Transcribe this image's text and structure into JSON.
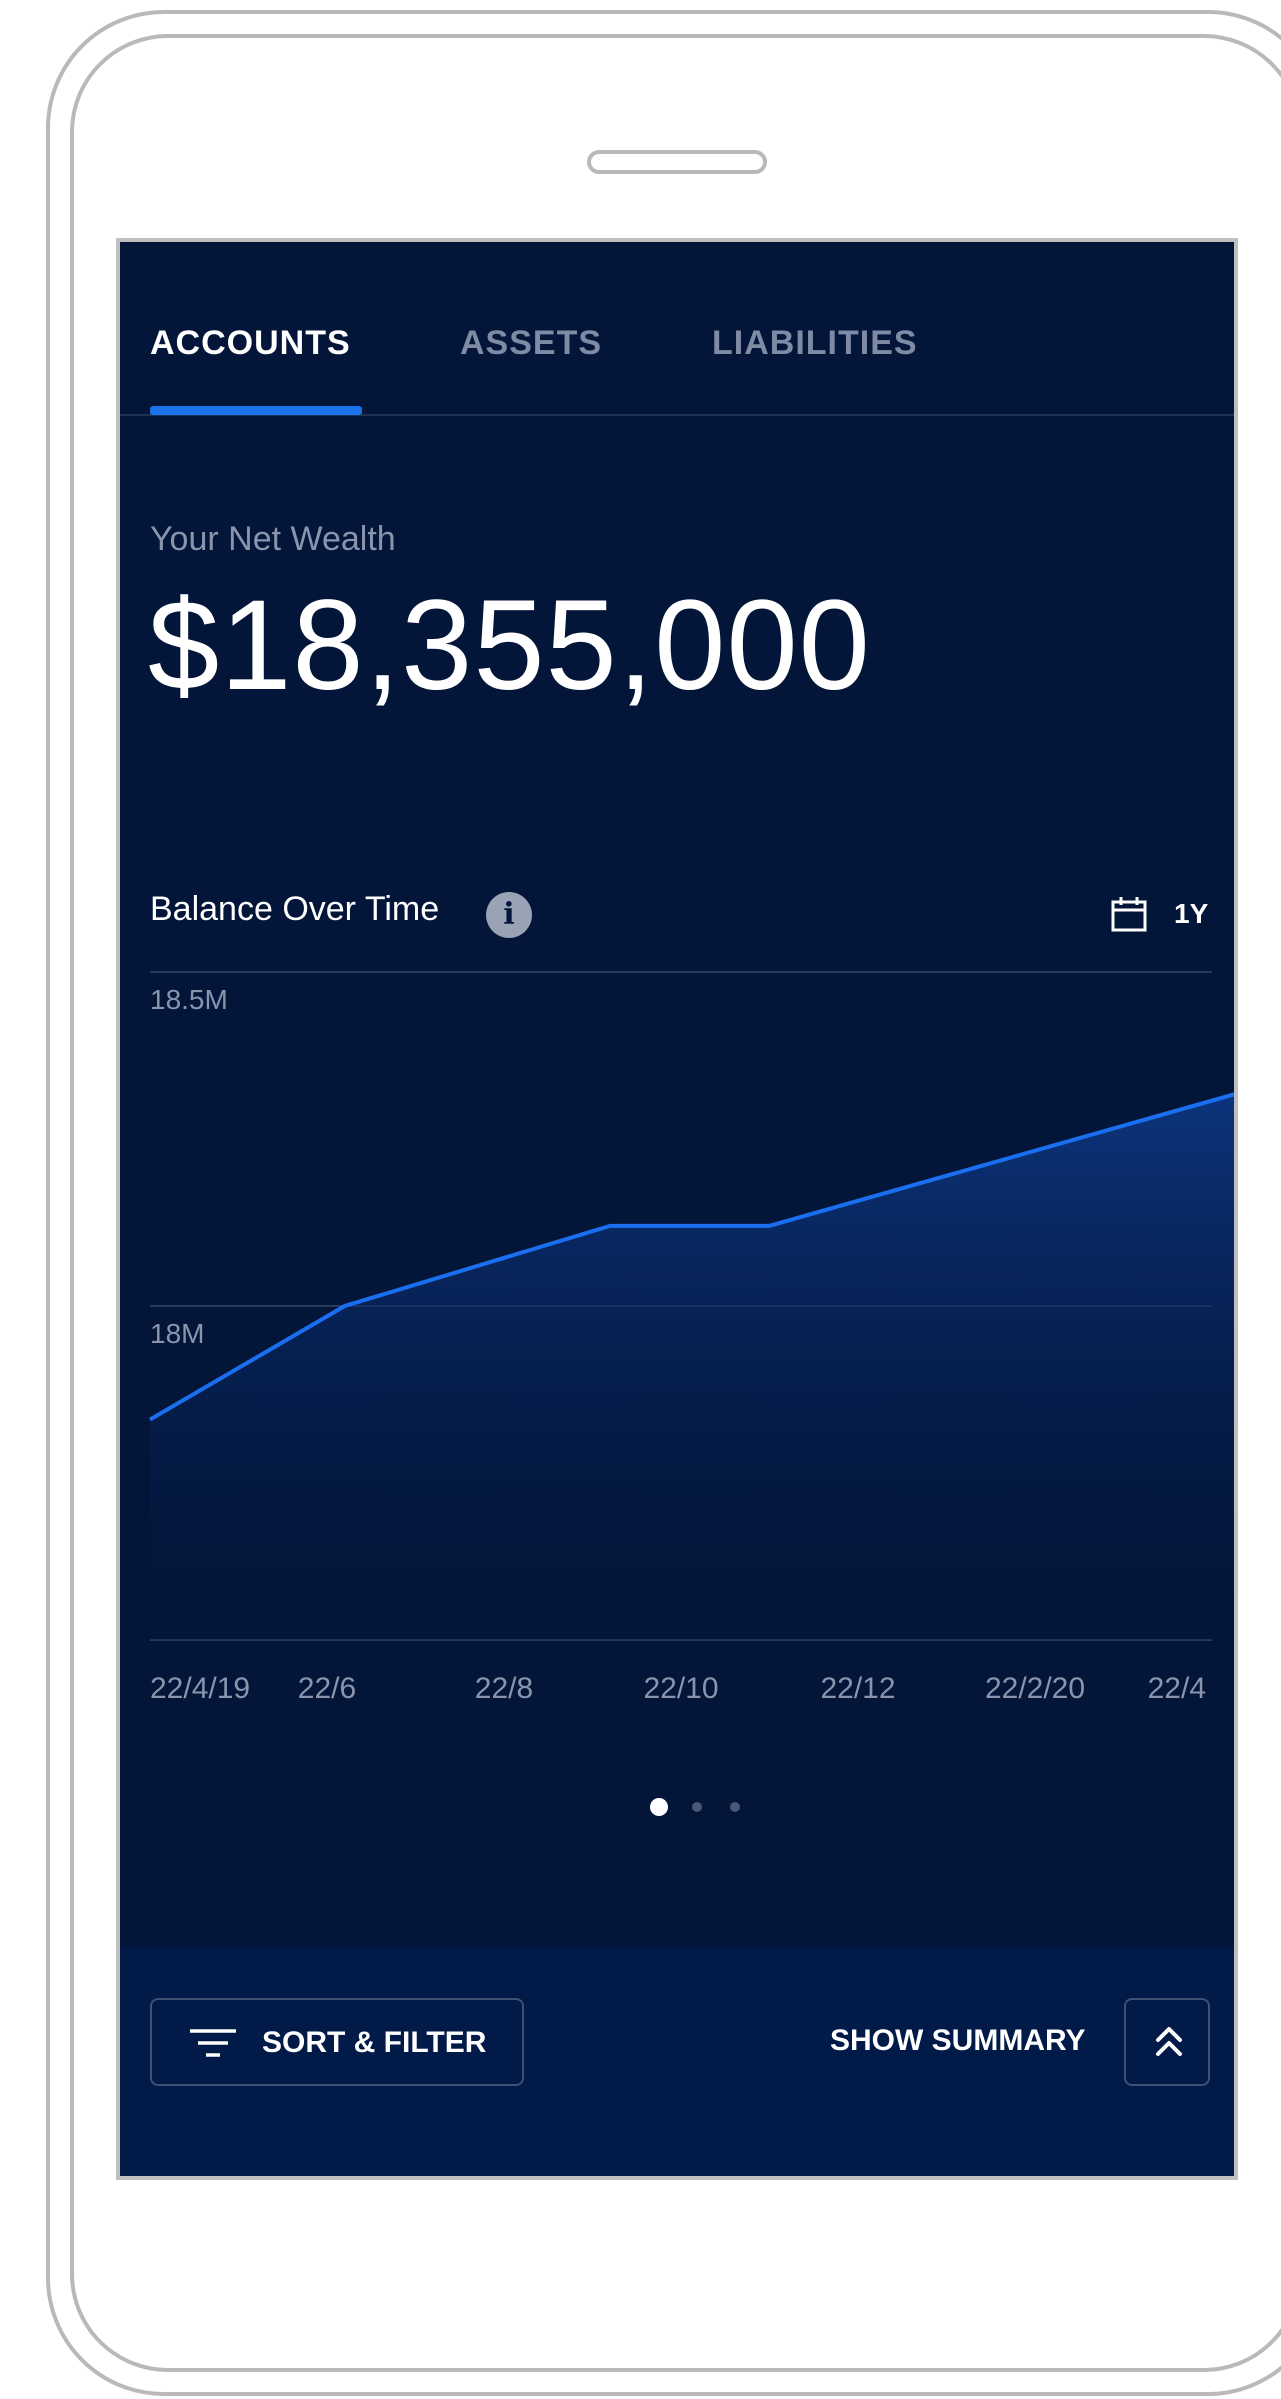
{
  "tabs": [
    {
      "label": "ACCOUNTS",
      "active": true
    },
    {
      "label": "ASSETS",
      "active": false
    },
    {
      "label": "LIABILITIES",
      "active": false
    }
  ],
  "net_wealth": {
    "label": "Your Net Wealth",
    "value": "$18,355,000"
  },
  "chart_header": {
    "title": "Balance Over Time",
    "info_icon": "info-icon",
    "calendar_icon": "calendar-icon",
    "range": "1Y"
  },
  "chart_data": {
    "type": "area",
    "title": "Balance Over Time",
    "x_tick_labels": [
      "22/4/19",
      "22/6",
      "22/8",
      "22/10",
      "22/12",
      "22/2/20",
      "22/4"
    ],
    "y_tick_labels": [
      "18.5M",
      "18M"
    ],
    "ylim": [
      17.5,
      18.5
    ],
    "x": [
      0,
      1.1,
      2.6,
      3.5,
      6.3
    ],
    "values": [
      17.83,
      18.0,
      18.12,
      18.12,
      18.33
    ],
    "line_color": "#1a6ff0",
    "grid": true
  },
  "carousel": {
    "pages": 3,
    "active_index": 0
  },
  "bottom_bar": {
    "sort_filter_label": "SORT & FILTER",
    "show_summary_label": "SHOW SUMMARY",
    "sort_icon": "filter-lines-icon",
    "summary_icon": "double-chevron-up-icon"
  },
  "colors": {
    "background": "#031539",
    "accent": "#1a73e8",
    "muted_text": "#8a95ad"
  }
}
